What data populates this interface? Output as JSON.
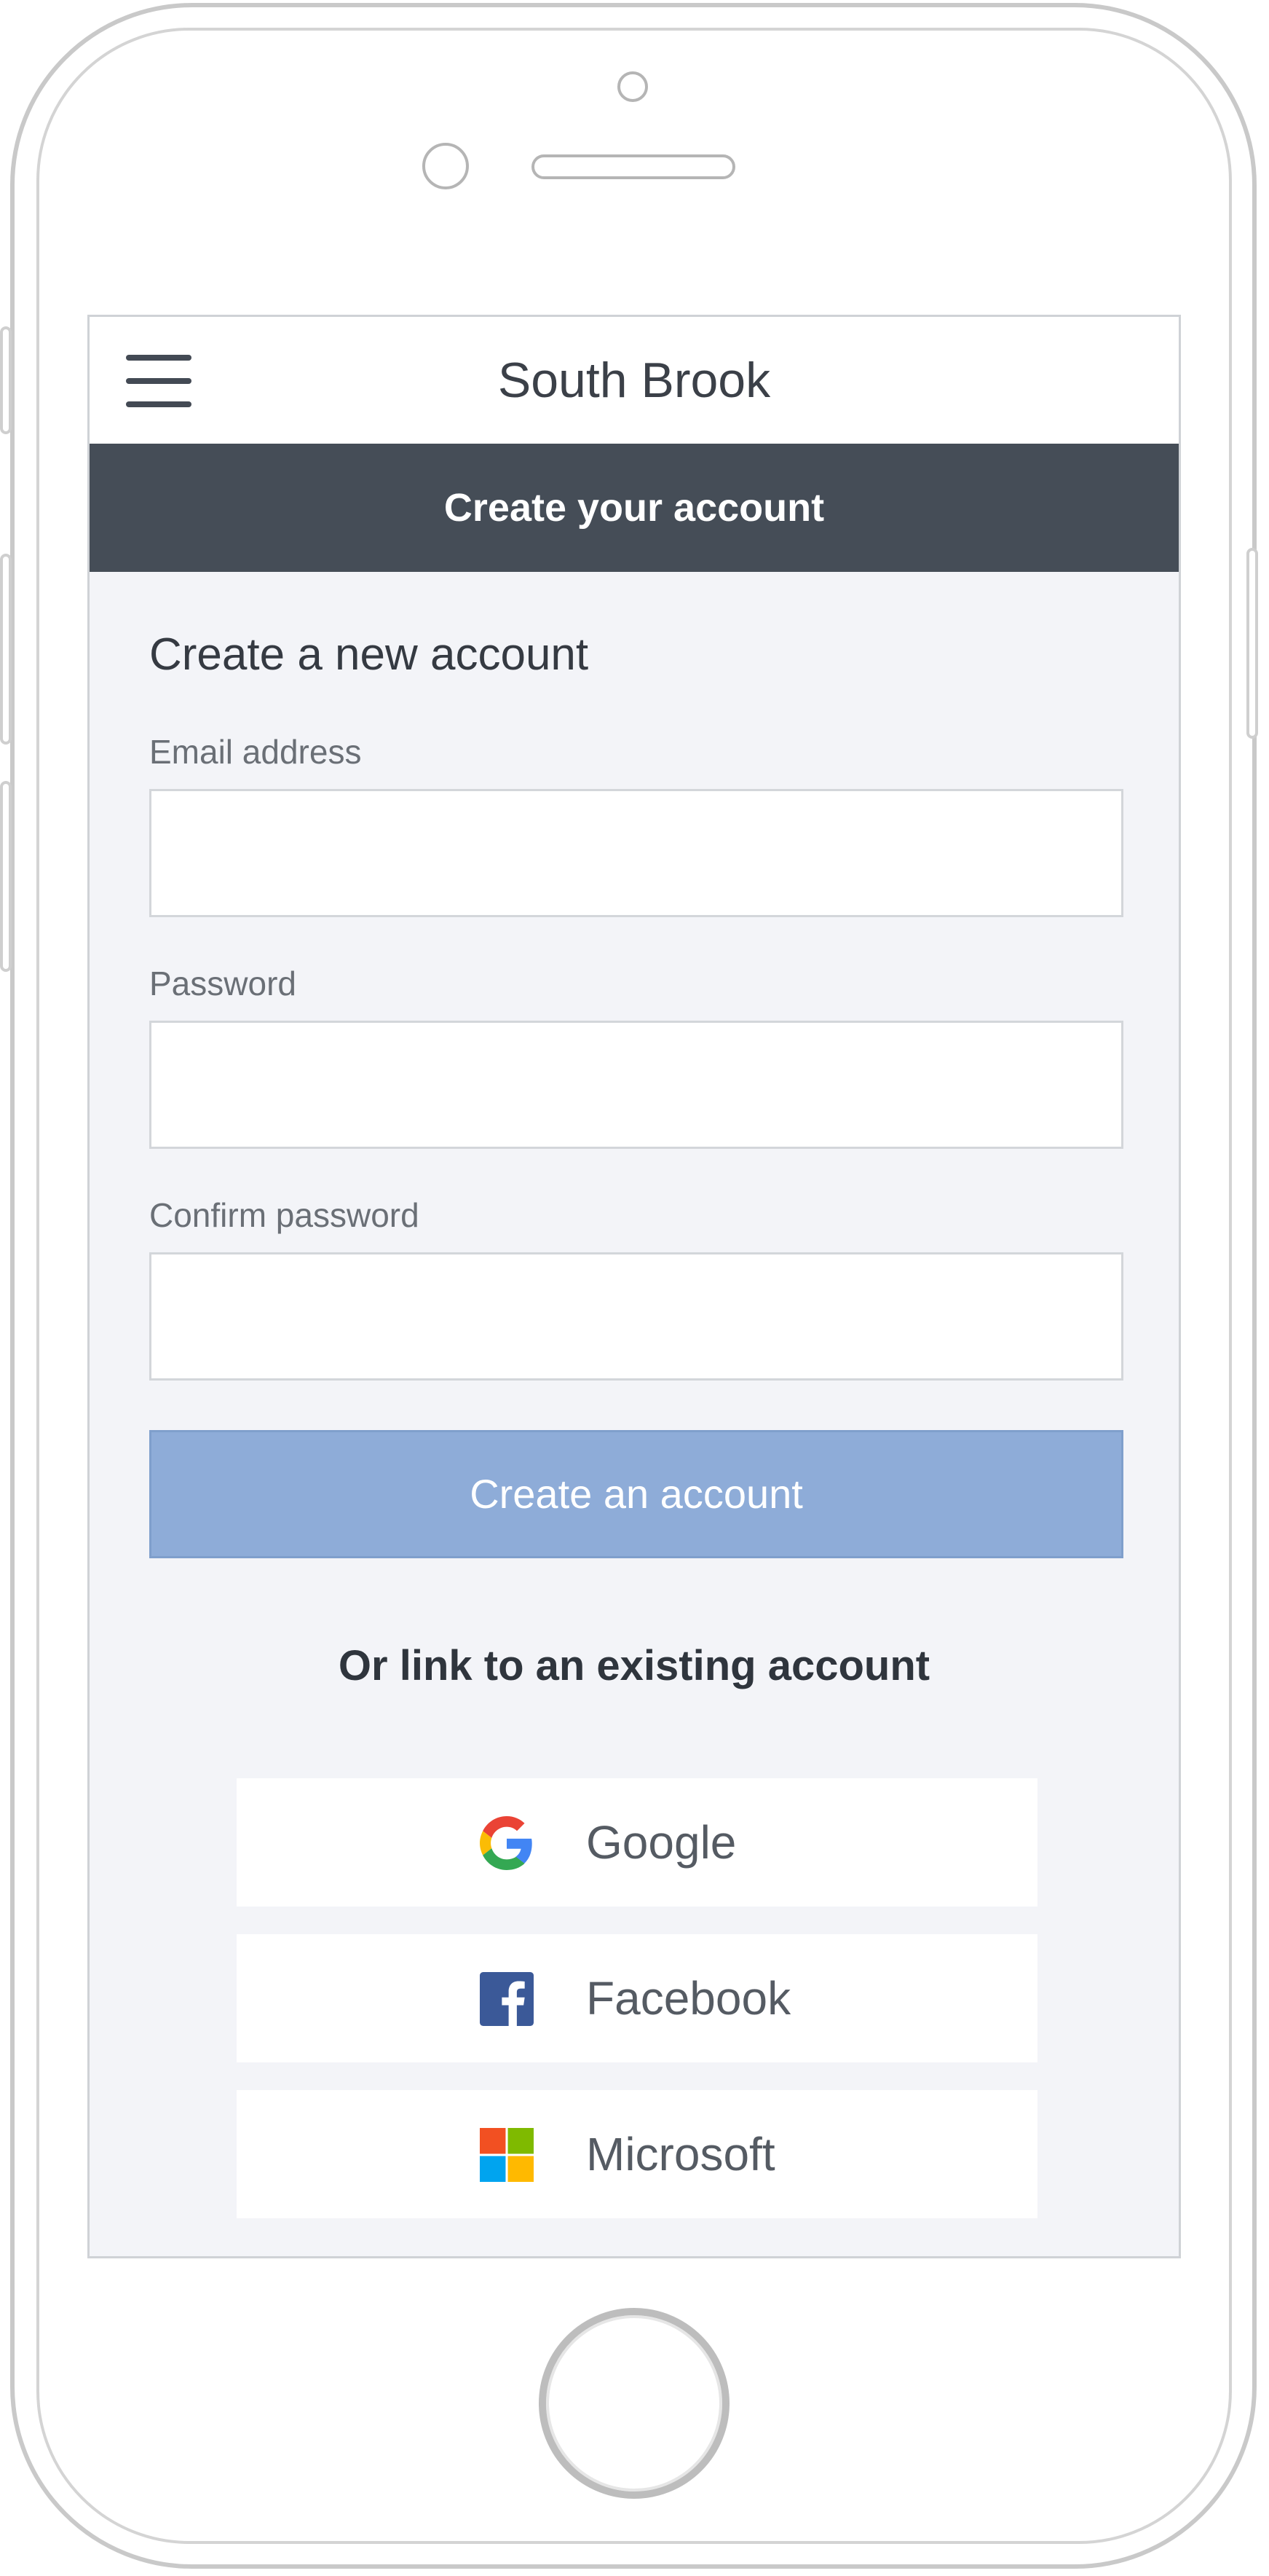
{
  "header": {
    "app_title": "South Brook",
    "menu_icon": "hamburger-menu-icon"
  },
  "banner": {
    "title": "Create your account"
  },
  "form": {
    "heading": "Create a new account",
    "email_label": "Email address",
    "email_value": "",
    "password_label": "Password",
    "password_value": "",
    "confirm_label": "Confirm password",
    "confirm_value": "",
    "submit_label": "Create an account"
  },
  "social": {
    "heading": "Or link to an existing account",
    "providers": [
      {
        "label": "Google",
        "icon": "google-icon"
      },
      {
        "label": "Facebook",
        "icon": "facebook-icon"
      },
      {
        "label": "Microsoft",
        "icon": "microsoft-icon"
      }
    ]
  },
  "colors": {
    "banner_bg": "#454d57",
    "screen_bg": "#f3f4f8",
    "button_disabled_bg": "#8eacd8",
    "facebook_blue": "#3b5998"
  }
}
